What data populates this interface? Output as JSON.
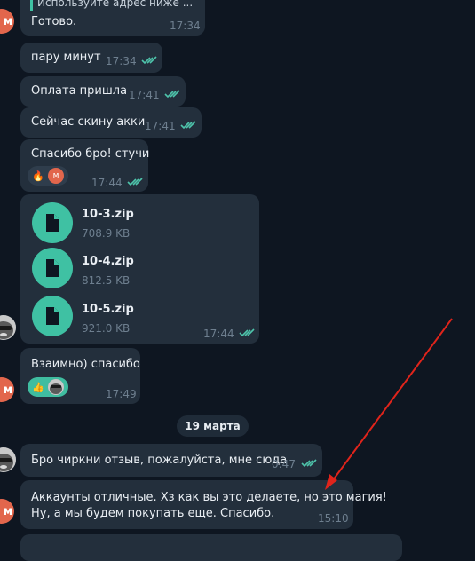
{
  "messages": {
    "m1": {
      "quote": "Используйте адрес ниже ...",
      "text": "Готово.",
      "time": "17:34"
    },
    "m2": {
      "text": "пару минут",
      "time": "17:34"
    },
    "m3": {
      "text": "Оплата пришла",
      "time": "17:41"
    },
    "m4": {
      "text": "Сейчас скину акки",
      "time": "17:41"
    },
    "m5": {
      "text": "Спасибо бро! стучи",
      "time": "17:44",
      "reactions": [
        "🔥",
        "м"
      ]
    },
    "files": {
      "items": [
        {
          "name": "10-3.zip",
          "size": "708.9 KB"
        },
        {
          "name": "10-4.zip",
          "size": "812.5 KB"
        },
        {
          "name": "10-5.zip",
          "size": "921.0 KB"
        }
      ],
      "time": "17:44"
    },
    "m6": {
      "text": "Взаимно) спасибо",
      "time": "17:49",
      "reactions": [
        "👍"
      ]
    },
    "date_separator": "19 марта",
    "m7": {
      "text": "Бро чиркни отзыв, пожалуйста, мне сюда",
      "time": "0:47"
    },
    "m8": {
      "line1": "Аккаунты отличные. Хз как вы это делаете, но это магия!",
      "line2": "Ну, а мы будем покупать еще. Спасибо.",
      "time": "15:10"
    }
  },
  "avatars": {
    "m_letter": "м"
  },
  "colors": {
    "background": "#0e1621",
    "bubble": "#232f3c",
    "accent": "#3fc1a3",
    "arrow": "#e0241b",
    "avatar_m": "#e2664c"
  }
}
